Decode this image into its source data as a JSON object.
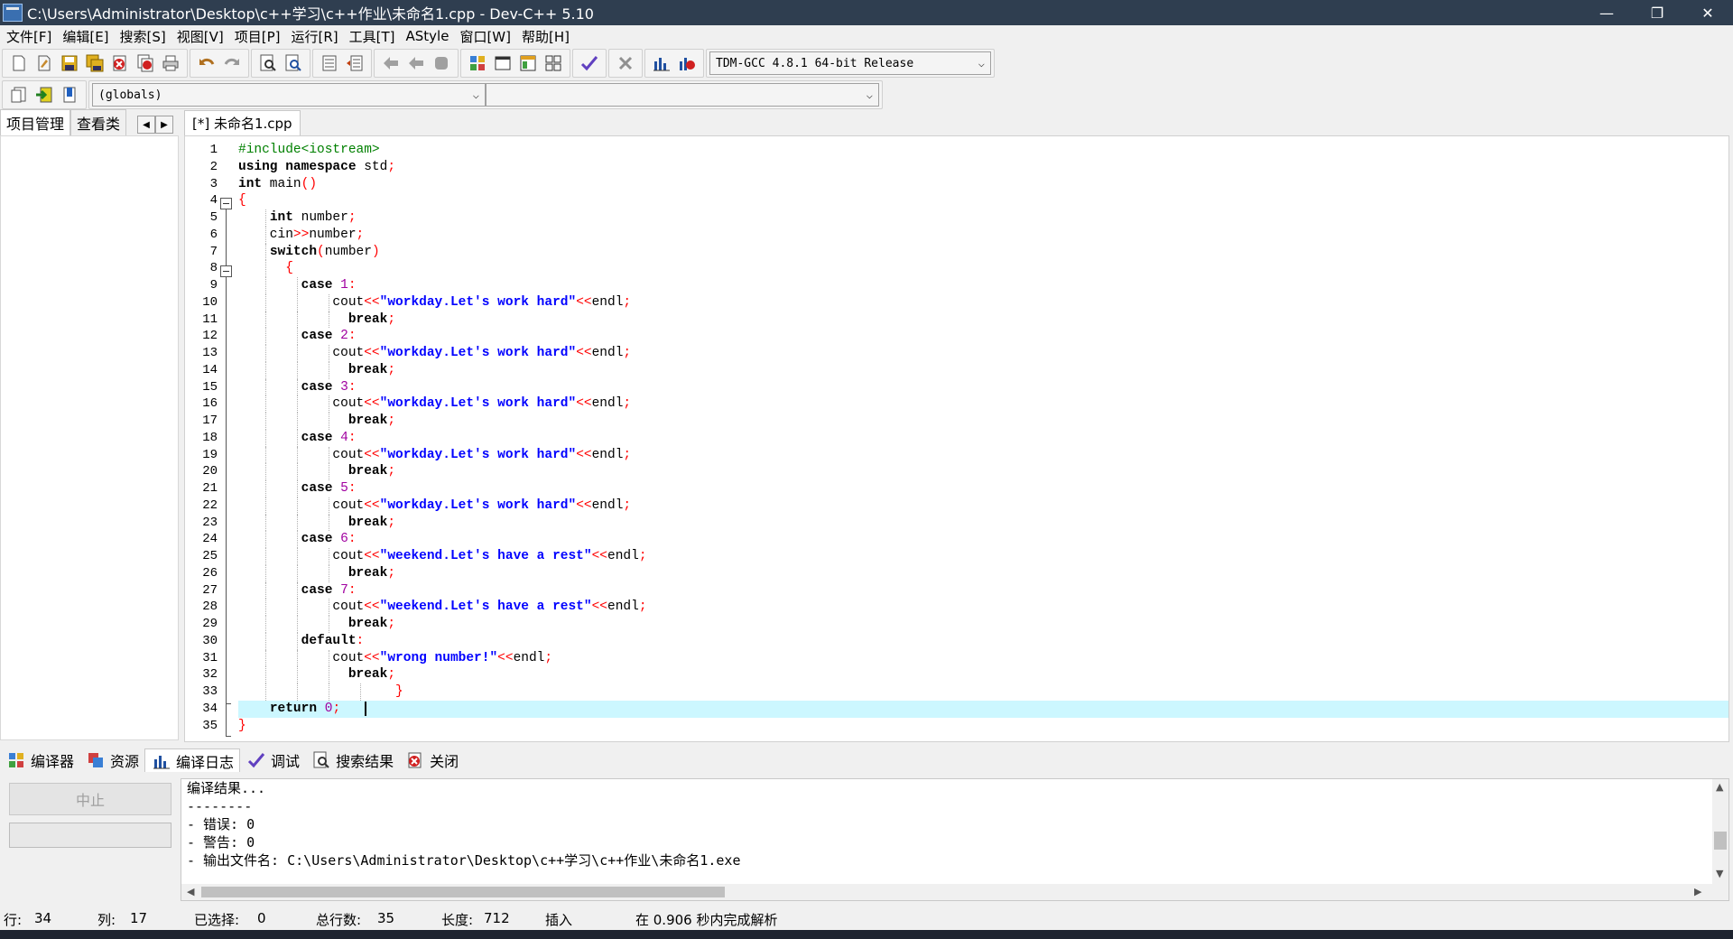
{
  "window": {
    "title": "C:\\Users\\Administrator\\Desktop\\c++学习\\c++作业\\未命名1.cpp - Dev-C++ 5.10",
    "minimize": "—",
    "restore": "❐",
    "close": "✕"
  },
  "menu": [
    "文件[F]",
    "编辑[E]",
    "搜索[S]",
    "视图[V]",
    "项目[P]",
    "运行[R]",
    "工具[T]",
    "AStyle",
    "窗口[W]",
    "帮助[H]"
  ],
  "toolbar": {
    "compiler_select": "TDM-GCC 4.8.1 64-bit Release",
    "scope_select": "(globals)",
    "member_select": ""
  },
  "left_panel": {
    "tabs": [
      "项目管理",
      "查看类"
    ]
  },
  "editor": {
    "tab": "[*] 未命名1.cpp",
    "line_numbers": [
      "1",
      "2",
      "3",
      "4",
      "5",
      "6",
      "7",
      "8",
      "9",
      "10",
      "11",
      "12",
      "13",
      "14",
      "15",
      "16",
      "17",
      "18",
      "19",
      "20",
      "21",
      "22",
      "23",
      "24",
      "25",
      "26",
      "27",
      "28",
      "29",
      "30",
      "31",
      "32",
      "33",
      "34",
      "35"
    ],
    "current_line": 34
  },
  "bottom_tabs": [
    "编译器",
    "资源",
    "编译日志",
    "调试",
    "搜索结果",
    "关闭"
  ],
  "bottom": {
    "abort_button": "中止",
    "log": [
      "编译结果...",
      "--------",
      "- 错误: 0",
      "- 警告: 0",
      "- 输出文件名: C:\\Users\\Administrator\\Desktop\\c++学习\\c++作业\\未命名1.exe"
    ]
  },
  "status": {
    "row_label": "行:",
    "row_value": "34",
    "col_label": "列:",
    "col_value": "17",
    "sel_label": "已选择:",
    "sel_value": "0",
    "total_label": "总行数:",
    "total_value": "35",
    "len_label": "长度:",
    "len_value": "712",
    "mode": "插入",
    "parse": "在 0.906 秒内完成解析"
  }
}
